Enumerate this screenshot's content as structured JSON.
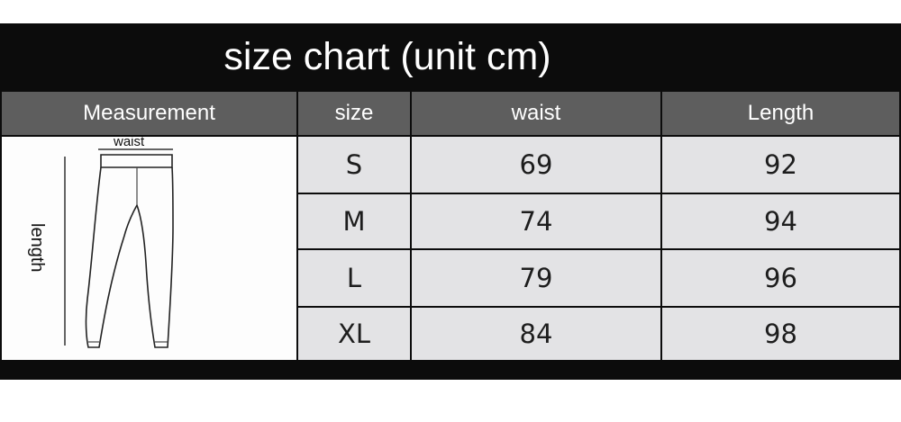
{
  "title": "size chart (unit cm)",
  "headers": {
    "measurement": "Measurement",
    "size": "size",
    "waist": "waist",
    "length": "Length"
  },
  "illustration": {
    "waist_label": "waist",
    "length_label": "length"
  },
  "rows": [
    {
      "size": "S",
      "waist": "69",
      "length": "92"
    },
    {
      "size": "M",
      "waist": "74",
      "length": "94"
    },
    {
      "size": "L",
      "waist": "79",
      "length": "96"
    },
    {
      "size": "XL",
      "waist": "84",
      "length": "98"
    }
  ]
}
